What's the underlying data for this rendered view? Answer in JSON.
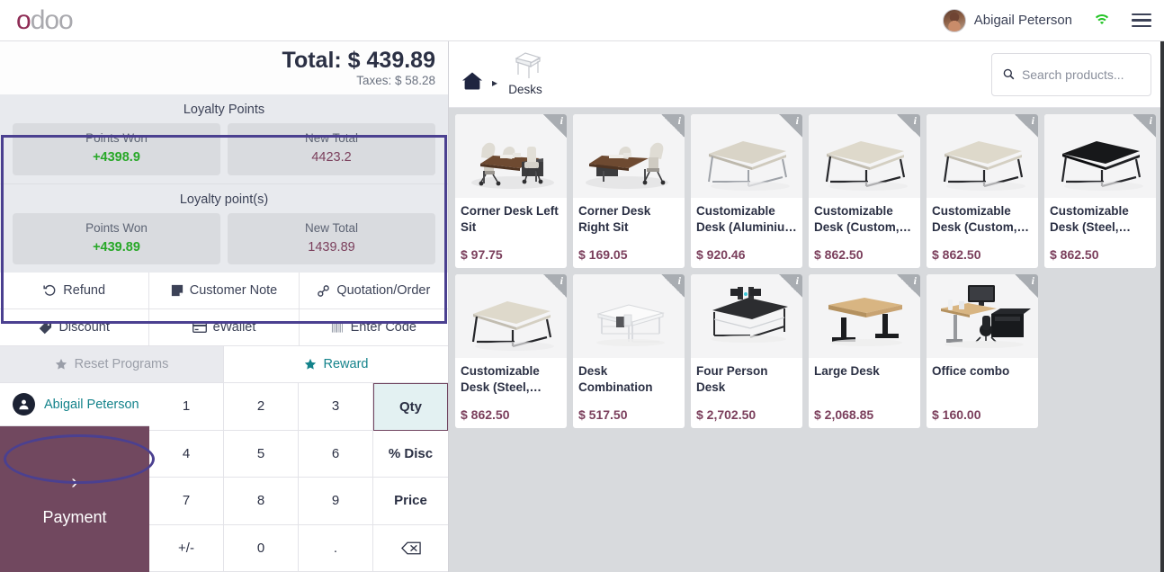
{
  "navbar": {
    "logo_text": "odoo",
    "logo_first_letter": "o",
    "logo_rest": "doo",
    "brand_color": "#8f2d56",
    "user_name": "Abigail Peterson",
    "avatar_icon": "user-photo-avatar",
    "wifi_icon": "wifi-icon",
    "wifi_color": "#23c425",
    "menu_icon": "hamburger-menu-icon"
  },
  "order": {
    "total_label": "Total: $ 439.89",
    "taxes_label": "Taxes: $ 58.28",
    "loyalty_programs": [
      {
        "title": "Loyalty Points",
        "points_won_label": "Points Won",
        "points_won_value": "+4398.9",
        "new_total_label": "New Total",
        "new_total_value": "4423.2"
      },
      {
        "title": "Loyalty point(s)",
        "points_won_label": "Points Won",
        "points_won_value": "+439.89",
        "new_total_label": "New Total",
        "new_total_value": "1439.89"
      }
    ],
    "gain_color": "#28a828",
    "total_color": "#7b3f5c",
    "control_buttons": [
      {
        "label": "Refund",
        "icon": "undo-arrow-icon"
      },
      {
        "label": "Customer Note",
        "icon": "sticky-note-icon"
      },
      {
        "label": "Quotation/Order",
        "icon": "link-chain-icon"
      },
      {
        "label": "Discount",
        "icon": "price-tag-icon"
      },
      {
        "label": "eWallet",
        "icon": "credit-card-icon"
      },
      {
        "label": "Enter Code",
        "icon": "barcode-icon"
      }
    ],
    "program_buttons": [
      {
        "label": "Reset Programs",
        "icon": "star-icon",
        "state": "disabled"
      },
      {
        "label": "Reward",
        "icon": "star-icon",
        "state": "enabled"
      }
    ],
    "customer_button": {
      "label": "Abigail Peterson",
      "icon": "person-icon"
    },
    "payment_button": {
      "label": "Payment",
      "icon": "chevron-right-icon",
      "color": "#71485f"
    },
    "numpad": [
      {
        "label": "1",
        "type": "digit"
      },
      {
        "label": "2",
        "type": "digit"
      },
      {
        "label": "3",
        "type": "digit"
      },
      {
        "label": "Qty",
        "type": "mode",
        "selected": true
      },
      {
        "label": "4",
        "type": "digit"
      },
      {
        "label": "5",
        "type": "digit"
      },
      {
        "label": "6",
        "type": "digit"
      },
      {
        "label": "% Disc",
        "type": "mode",
        "selected": false
      },
      {
        "label": "7",
        "type": "digit"
      },
      {
        "label": "8",
        "type": "digit"
      },
      {
        "label": "9",
        "type": "digit"
      },
      {
        "label": "Price",
        "type": "mode",
        "selected": false
      },
      {
        "label": "+/-",
        "type": "digit"
      },
      {
        "label": "0",
        "type": "digit"
      },
      {
        "label": ".",
        "type": "digit"
      },
      {
        "label": "",
        "type": "backspace",
        "icon": "backspace-icon"
      }
    ]
  },
  "annotations": {
    "rect_target": "loyalty-points-panel",
    "ellipse_target": "customer-button",
    "color": "#4b4090"
  },
  "products": {
    "breadcrumb": {
      "home_icon": "home-icon",
      "separator": "▸",
      "category_label": "Desks",
      "category_icon": "desk-icon"
    },
    "search": {
      "placeholder": "Search products...",
      "value": "",
      "icon": "search-icon"
    },
    "info_badge_letter": "i",
    "items": [
      {
        "name": "Corner Desk Left Sit",
        "price": "$ 97.75",
        "image": "corner-desk-left-sit"
      },
      {
        "name": "Corner Desk Right Sit",
        "price": "$ 169.05",
        "image": "corner-desk-right-sit"
      },
      {
        "name": "Customizable Desk (Aluminiu…",
        "price": "$ 920.46",
        "image": "customizable-desk-aluminium"
      },
      {
        "name": "Customizable Desk (Custom,…",
        "price": "$ 862.50",
        "image": "customizable-desk-custom-1"
      },
      {
        "name": "Customizable Desk (Custom,…",
        "price": "$ 862.50",
        "image": "customizable-desk-custom-2"
      },
      {
        "name": "Customizable Desk (Steel,…",
        "price": "$ 862.50",
        "image": "customizable-desk-steel-black"
      },
      {
        "name": "Customizable Desk (Steel,…",
        "price": "$ 862.50",
        "image": "customizable-desk-steel-white"
      },
      {
        "name": "Desk Combination",
        "price": "$ 517.50",
        "image": "desk-combination"
      },
      {
        "name": "Four Person Desk",
        "price": "$ 2,702.50",
        "image": "four-person-desk"
      },
      {
        "name": "Large Desk",
        "price": "$ 2,068.85",
        "image": "large-desk"
      },
      {
        "name": "Office combo",
        "price": "$ 160.00",
        "image": "office-combo"
      }
    ]
  }
}
